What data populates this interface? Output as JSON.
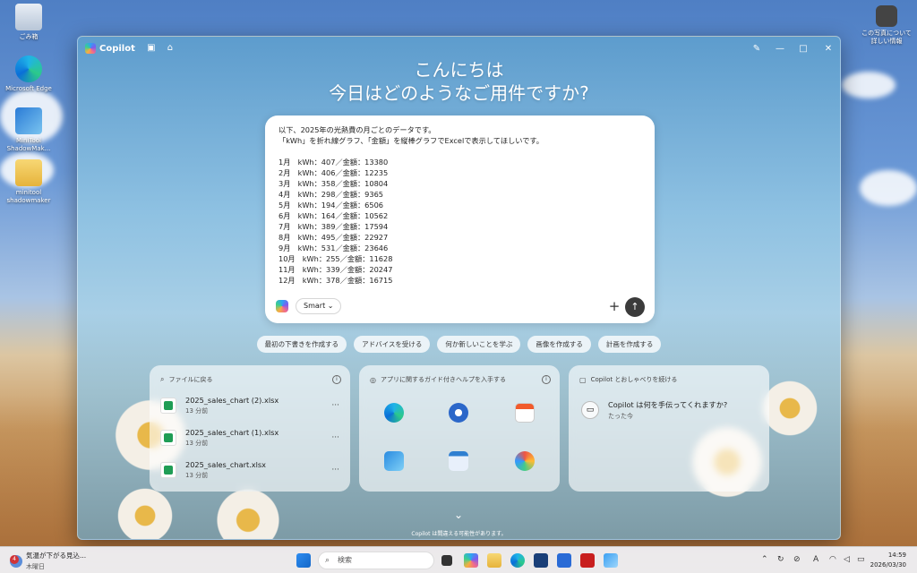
{
  "desktop": {
    "icons": [
      {
        "label": "ごみ箱"
      },
      {
        "label": "Microsoft Edge"
      },
      {
        "label": "MiniTool ShadowMak..."
      },
      {
        "label": "minitool shadowmaker"
      }
    ],
    "right_icon": {
      "line1": "この写真について",
      "line2": "詳しい情報"
    }
  },
  "copilot": {
    "app_name": "Copilot",
    "greeting_line1": "こんにちは",
    "greeting_line2": "今日はどのようなご用件ですか?",
    "composer": {
      "lines": [
        "以下、2025年の光熱費の月ごとのデータです。",
        "「kWh」を折れ線グラフ、「金額」を縦棒グラフでExcelで表示してほしいです。",
        "",
        "1月　kWh：407／金額：13380",
        "2月　kWh：406／金額：12235",
        "3月　kWh：358／金額：10804",
        "4月　kWh：298／金額：9365",
        "5月　kWh：194／金額：6506",
        "6月　kWh：164／金額：10562",
        "7月　kWh：389／金額：17594",
        "8月　kWh：495／金額：22927",
        "9月　kWh：531／金額：23646",
        "10月　kWh：255／金額：11628",
        "11月　kWh：339／金額：20247",
        "12月　kWh：378／金額：16715"
      ],
      "mode_label": "Smart",
      "plus_glyph": "+",
      "send_glyph": "↑"
    },
    "chips": [
      "最初の下書きを作成する",
      "アドバイスを受ける",
      "何か新しいことを学ぶ",
      "画像を作成する",
      "計画を作成する"
    ],
    "cards": {
      "files": {
        "title": "ファイルに戻る",
        "items": [
          {
            "name": "2025_sales_chart (2).xlsx",
            "time": "13 分前"
          },
          {
            "name": "2025_sales_chart (1).xlsx",
            "time": "13 分前"
          },
          {
            "name": "2025_sales_chart.xlsx",
            "time": "13 分前"
          }
        ]
      },
      "apps": {
        "title": "アプリに関するガイド付きヘルプを入手する"
      },
      "chat": {
        "title": "Copilot とおしゃべりを続ける",
        "question": "Copilot は何を手伝ってくれますか?",
        "time": "たった今"
      }
    },
    "disclaimer": "Copilot は間違える可能性があります。"
  },
  "taskbar": {
    "weather_line1": "気温が下がる見込...",
    "weather_line2": "木曜日",
    "badge": "4",
    "search_placeholder": "検索",
    "time": "14:59",
    "date": "2026/03/30",
    "ime": "A"
  }
}
